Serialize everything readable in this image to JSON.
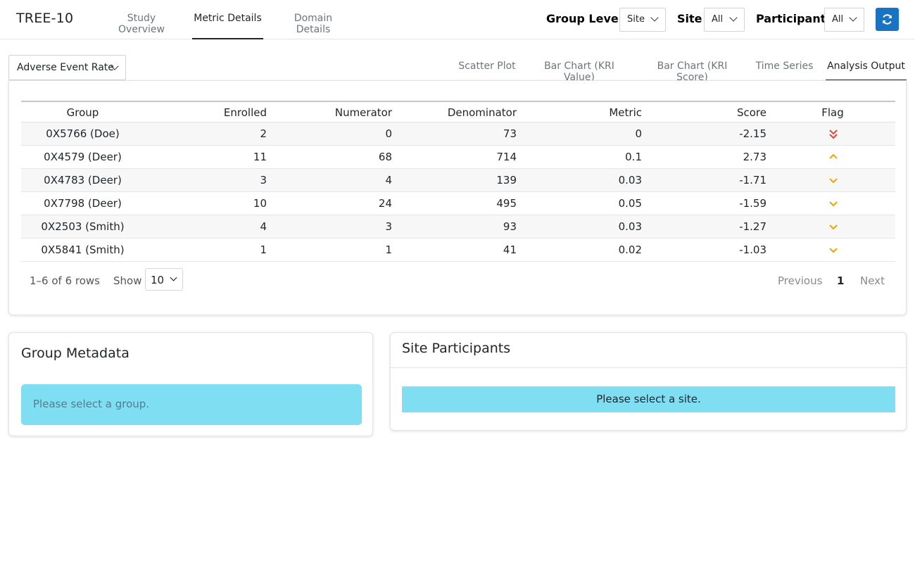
{
  "app": {
    "title": "TREE-10"
  },
  "nav_tabs": [
    {
      "label": "Study Overview",
      "active": false
    },
    {
      "label": "Metric Details",
      "active": true
    },
    {
      "label": "Domain Details",
      "active": false
    }
  ],
  "filters": {
    "group_level": {
      "label": "Group Level",
      "value": "Site"
    },
    "site": {
      "label": "Site",
      "value": "All"
    },
    "participant": {
      "label": "Participant",
      "value": "All"
    },
    "refresh_icon": "refresh-icon"
  },
  "metric_select": {
    "value": "Adverse Event Rate"
  },
  "chart_tabs": [
    {
      "label": "Scatter Plot",
      "active": false
    },
    {
      "label": "Bar Chart (KRI Value)",
      "active": false
    },
    {
      "label": "Bar Chart (KRI Score)",
      "active": false
    },
    {
      "label": "Time Series",
      "active": false
    },
    {
      "label": "Analysis Output",
      "active": true
    }
  ],
  "table": {
    "columns": [
      "Group",
      "Enrolled",
      "Numerator",
      "Denominator",
      "Metric",
      "Score",
      "Flag"
    ],
    "rows": [
      {
        "group": "0X5766 (Doe)",
        "enrolled": "2",
        "numerator": "0",
        "denominator": "73",
        "metric": "0",
        "score": "-2.15",
        "flag": "double-chevron-down-icon"
      },
      {
        "group": "0X4579 (Deer)",
        "enrolled": "11",
        "numerator": "68",
        "denominator": "714",
        "metric": "0.1",
        "score": "2.73",
        "flag": "chevron-up-icon"
      },
      {
        "group": "0X4783 (Deer)",
        "enrolled": "3",
        "numerator": "4",
        "denominator": "139",
        "metric": "0.03",
        "score": "-1.71",
        "flag": "chevron-down-icon"
      },
      {
        "group": "0X7798 (Deer)",
        "enrolled": "10",
        "numerator": "24",
        "denominator": "495",
        "metric": "0.05",
        "score": "-1.59",
        "flag": "chevron-down-icon"
      },
      {
        "group": "0X2503 (Smith)",
        "enrolled": "4",
        "numerator": "3",
        "denominator": "93",
        "metric": "0.03",
        "score": "-1.27",
        "flag": "chevron-down-icon"
      },
      {
        "group": "0X5841 (Smith)",
        "enrolled": "1",
        "numerator": "1",
        "denominator": "41",
        "metric": "0.02",
        "score": "-1.03",
        "flag": "chevron-down-icon"
      }
    ],
    "footer": {
      "row_info": "1–6 of 6 rows",
      "show_label": "Show",
      "page_size": "10",
      "prev": "Previous",
      "current_page": "1",
      "next": "Next"
    }
  },
  "group_metadata": {
    "title": "Group Metadata",
    "message": "Please select a group."
  },
  "site_participants": {
    "title": "Site Participants",
    "message": "Please select a site."
  },
  "colors": {
    "accent": "#1874c3",
    "flag_red": "#e8453c",
    "flag_amber": "#f0a500",
    "alert_info": "#7fdef2"
  }
}
